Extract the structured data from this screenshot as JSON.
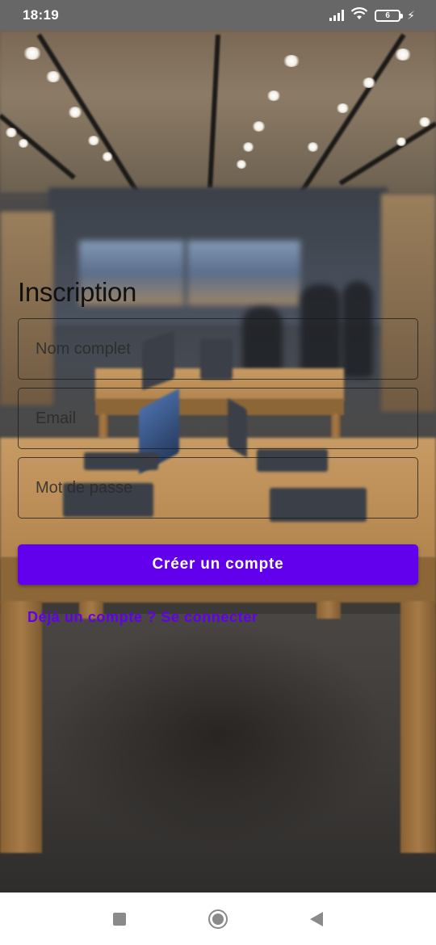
{
  "status_bar": {
    "time": "18:19",
    "battery_level": "6",
    "icons": [
      "signal-icon",
      "wifi-icon",
      "battery-icon",
      "charging-bolt-icon"
    ]
  },
  "form": {
    "title": "Inscription",
    "fields": {
      "full_name": {
        "placeholder": "Nom complet",
        "value": ""
      },
      "email": {
        "placeholder": "Email",
        "value": ""
      },
      "password": {
        "placeholder": "Mot de passe",
        "value": ""
      }
    },
    "submit_label": "Créer un compte",
    "login_link": "Déjà un compte ? Se connecter"
  },
  "nav_bar": {
    "icons": [
      "recents-square-icon",
      "home-circle-icon",
      "back-triangle-icon"
    ]
  },
  "colors": {
    "accent": "#6200ee",
    "status_bar_bg": "#676767",
    "nav_bar_bg": "#ffffff",
    "button_text": "#ffffff"
  }
}
